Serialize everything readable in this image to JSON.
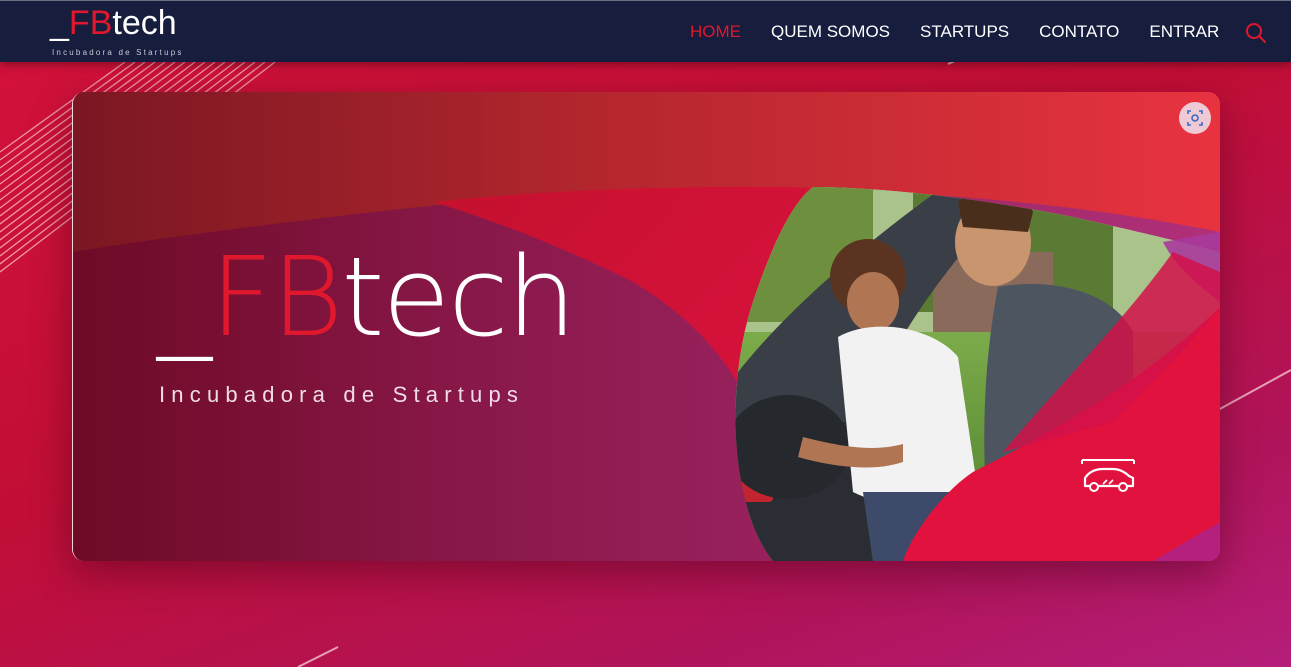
{
  "header": {
    "logo": {
      "prefix": "_",
      "highlight": "FB",
      "suffix": "tech",
      "tagline": "Incubadora de Startups"
    },
    "nav": [
      {
        "label": "HOME",
        "active": true
      },
      {
        "label": "QUEM SOMOS",
        "active": false
      },
      {
        "label": "STARTUPS",
        "active": false
      },
      {
        "label": "CONTATO",
        "active": false
      },
      {
        "label": "ENTRAR",
        "active": false
      }
    ],
    "search_icon": "search-icon"
  },
  "banner": {
    "title_prefix": "_",
    "title_highlight": "FB",
    "title_suffix": "tech",
    "subtitle": "Incubadora de Startups",
    "photo": "woman-and-man-loading-car-trunk",
    "lens_icon": "visual-search-icon",
    "car_icon": "car-icon"
  },
  "colors": {
    "navbar": "#161d3d",
    "brand_red": "#e0182d",
    "background": "#c20e36",
    "banner_purple": "#a8276c"
  }
}
